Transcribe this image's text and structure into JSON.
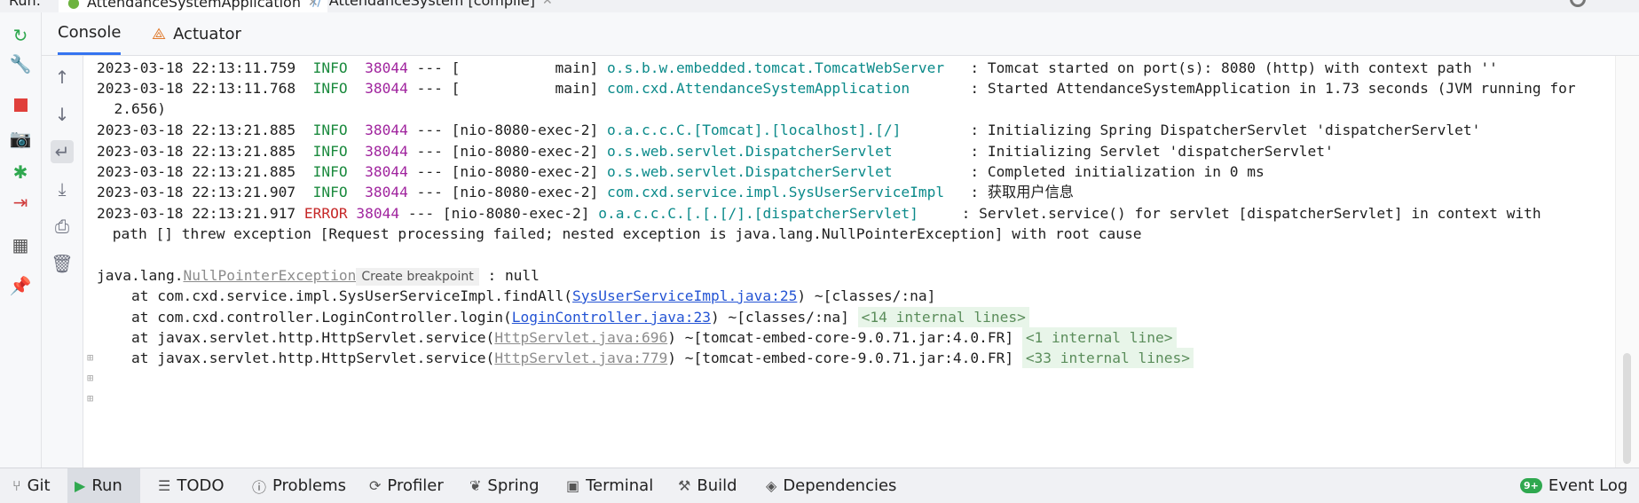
{
  "run_tabs": {
    "run_label": "Run:",
    "tabs": [
      {
        "label": "AttendanceSystemApplication"
      },
      {
        "label": "AttendanceSystem [compile]"
      }
    ]
  },
  "console_tabs": [
    {
      "label": "Console"
    },
    {
      "label": "Actuator"
    }
  ],
  "log": [
    {
      "ts": "2023-03-18 22:13:11.759",
      "level": "INFO ",
      "pid": "38044",
      "sep": " --- [",
      "thread": "           main",
      "close": "] ",
      "logger": "o.s.b.w.embedded.tomcat.TomcatWebServer  ",
      "msg": ": Tomcat started on port(s): 8080 (http) with context path ''"
    },
    {
      "ts": "2023-03-18 22:13:11.768",
      "level": "INFO ",
      "pid": "38044",
      "sep": " --- [",
      "thread": "           main",
      "close": "] ",
      "logger": "com.cxd.AttendanceSystemApplication      ",
      "msg": ": Started AttendanceSystemApplication in 1.73 seconds (JVM running for"
    },
    {
      "ts": "2023-03-18 22:13:21.885",
      "level": "INFO ",
      "pid": "38044",
      "sep": " --- [",
      "thread": "nio-8080-exec-2",
      "close": "] ",
      "logger": "o.a.c.c.C.[Tomcat].[localhost].[/]       ",
      "msg": ": Initializing Spring DispatcherServlet 'dispatcherServlet'"
    },
    {
      "ts": "2023-03-18 22:13:21.885",
      "level": "INFO ",
      "pid": "38044",
      "sep": " --- [",
      "thread": "nio-8080-exec-2",
      "close": "] ",
      "logger": "o.s.web.servlet.DispatcherServlet        ",
      "msg": ": Initializing Servlet 'dispatcherServlet'"
    },
    {
      "ts": "2023-03-18 22:13:21.885",
      "level": "INFO ",
      "pid": "38044",
      "sep": " --- [",
      "thread": "nio-8080-exec-2",
      "close": "] ",
      "logger": "o.s.web.servlet.DispatcherServlet        ",
      "msg": ": Completed initialization in 0 ms"
    },
    {
      "ts": "2023-03-18 22:13:21.907",
      "level": "INFO ",
      "pid": "38044",
      "sep": " --- [",
      "thread": "nio-8080-exec-2",
      "close": "] ",
      "logger": "com.cxd.service.impl.SysUserServiceImpl  ",
      "msg": ": 获取用户信息"
    },
    {
      "ts": "2023-03-18 22:13:21.917",
      "level": "ERROR",
      "pid": "38044",
      "sep": " --- [",
      "thread": "nio-8080-exec-2",
      "close": "] ",
      "logger": "o.a.c.c.C.[.[.[/].[dispatcherServlet]    ",
      "msg": ": Servlet.service() for servlet [dispatcherServlet] in context with"
    }
  ],
  "wrap_jvm": "  2.656)",
  "wrap_error": " path [] threw exception [Request processing failed; nested exception is java.lang.NullPointerException] with root cause",
  "exception": {
    "prefix": "java.lang.",
    "name": "NullPointerException",
    "breakpoint": "Create breakpoint",
    "suffix": " : null"
  },
  "stack": [
    {
      "pre": "    at com.cxd.service.impl.SysUserServiceImpl.findAll(",
      "link": "SysUserServiceImpl.java:25",
      "post": ") ~[classes/:na]",
      "internal": ""
    },
    {
      "pre": "    at com.cxd.controller.LoginController.login(",
      "link": "LoginController.java:23",
      "post": ") ~[classes/:na] ",
      "internal": "<14 internal lines>"
    },
    {
      "pre": "    at javax.servlet.http.HttpServlet.service(",
      "link": "HttpServlet.java:696",
      "post": ") ~[tomcat-embed-core-9.0.71.jar:4.0.FR] ",
      "internal": "<1 internal line>"
    },
    {
      "pre": "    at javax.servlet.http.HttpServlet.service(",
      "link": "HttpServlet.java:779",
      "post": ") ~[tomcat-embed-core-9.0.71.jar:4.0.FR] ",
      "internal": "<33 internal lines>"
    }
  ],
  "bottom_tabs": [
    {
      "label": "Git"
    },
    {
      "label": "Run"
    },
    {
      "label": "TODO"
    },
    {
      "label": "Problems"
    },
    {
      "label": "Profiler"
    },
    {
      "label": "Spring"
    },
    {
      "label": "Terminal"
    },
    {
      "label": "Build"
    },
    {
      "label": "Dependencies"
    }
  ],
  "event_log": {
    "label": "Event Log",
    "badge": "9+"
  },
  "colors": {
    "accent": "#3574f0",
    "info": "#1b8a3e",
    "error": "#c62828",
    "pid": "#a0249e",
    "logger": "#0b8a8a",
    "link": "#2454d4"
  }
}
